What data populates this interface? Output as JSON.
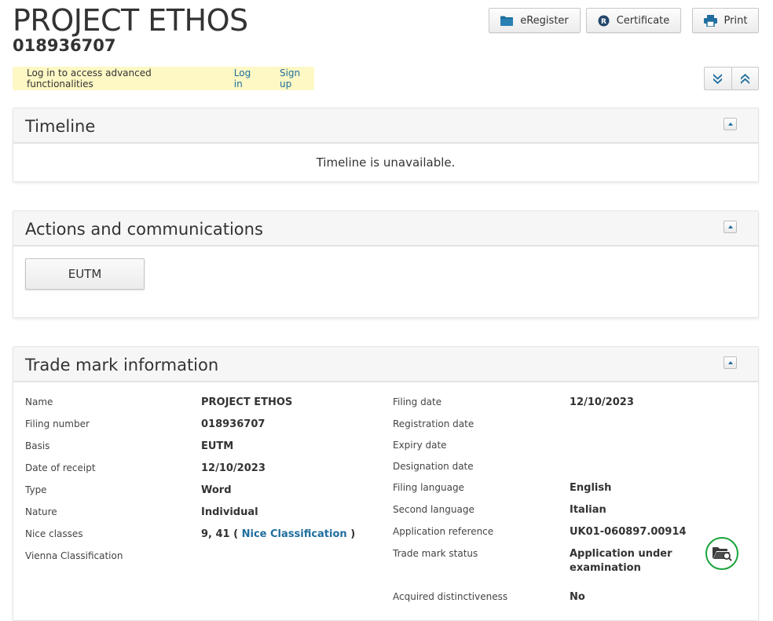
{
  "header": {
    "title": "PROJECT ETHOS",
    "subtitle": "018936707"
  },
  "toolbar": {
    "eregister_label": "eRegister",
    "certificate_label": "Certificate",
    "print_label": "Print"
  },
  "login_bar": {
    "message": "Log in to access advanced functionalities",
    "login_label": "Log in",
    "signup_label": "Sign up"
  },
  "timeline": {
    "title": "Timeline",
    "message": "Timeline is unavailable."
  },
  "actions": {
    "title": "Actions and communications",
    "eutm_label": "EUTM"
  },
  "trademark": {
    "title": "Trade mark information",
    "left": [
      {
        "label": "Name",
        "value": "PROJECT ETHOS"
      },
      {
        "label": "Filing number",
        "value": "018936707"
      },
      {
        "label": "Basis",
        "value": "EUTM"
      },
      {
        "label": "Date of receipt",
        "value": "12/10/2023"
      },
      {
        "label": "Type",
        "value": "Word"
      },
      {
        "label": "Nature",
        "value": "Individual"
      },
      {
        "label": "Nice classes",
        "value": "9, 41 (",
        "link": "Nice Classification",
        "suffix": ")"
      },
      {
        "label": "Vienna Classification",
        "value": ""
      }
    ],
    "right": [
      {
        "label": "Filing date",
        "value": "12/10/2023"
      },
      {
        "label": "Registration date",
        "value": ""
      },
      {
        "label": "Expiry date",
        "value": ""
      },
      {
        "label": "Designation date",
        "value": ""
      },
      {
        "label": "Filing language",
        "value": "English"
      },
      {
        "label": "Second language",
        "value": "Italian"
      },
      {
        "label": "Application reference",
        "value": "UK01-060897.00914"
      },
      {
        "label": "Trade mark status",
        "value": "Application under examination"
      },
      {
        "label": "Acquired distinctiveness",
        "value": "No"
      }
    ]
  },
  "colors": {
    "link": "#1f6e9e",
    "login_bar_bg": "#fdf8c4",
    "status_ring": "#1aa33a",
    "icon_blue": "#1f6e9e"
  }
}
